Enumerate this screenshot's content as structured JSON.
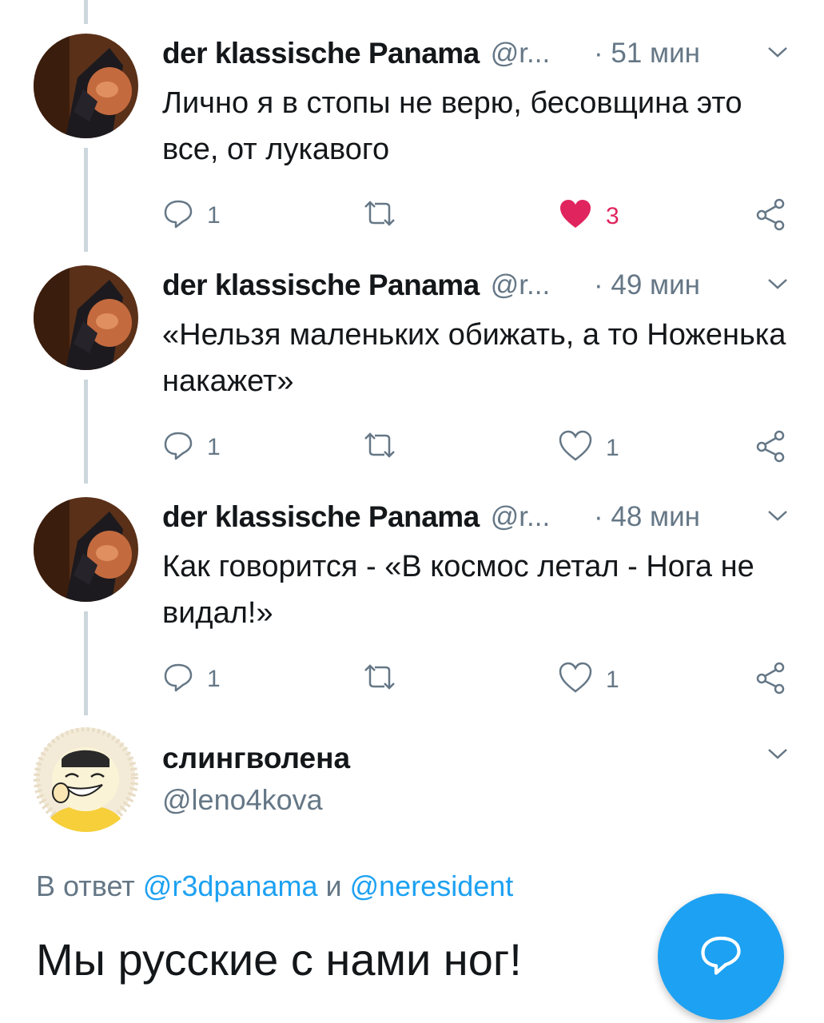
{
  "tweets": [
    {
      "name": "der klassische Panama",
      "handle": "@r...",
      "time": "· 51 мин",
      "text": "Лично я в стопы не верю, бесовщина это все, от лукавого",
      "reply_count": "1",
      "like_count": "3",
      "liked": true
    },
    {
      "name": "der klassische Panama",
      "handle": "@r...",
      "time": "· 49 мин",
      "text": "«Нельзя маленьких обижать, а то Ноженька накажет»",
      "reply_count": "1",
      "like_count": "1",
      "liked": false
    },
    {
      "name": "der klassische Panama",
      "handle": "@r...",
      "time": "· 48 мин",
      "text": "Как говорится - «В космос летал - Нога не видал!»",
      "reply_count": "1",
      "like_count": "1",
      "liked": false
    }
  ],
  "reply": {
    "name": "слингволена",
    "handle": "@leno4kova",
    "reply_prefix": "В ответ",
    "mention_1": "@r3dpanama",
    "conjunction": "и",
    "mention_2": "@neresident",
    "text": "Мы русские с нами ног!"
  },
  "colors": {
    "accent": "#1da1f2",
    "like": "#e0245e",
    "secondary_text": "#657786",
    "thread_line": "#ccd6dd"
  },
  "icons": {
    "reply": "reply-icon",
    "retweet": "retweet-icon",
    "like": "heart-icon",
    "share": "share-icon",
    "caret": "chevron-down-icon",
    "compose": "compose-reply-icon"
  }
}
